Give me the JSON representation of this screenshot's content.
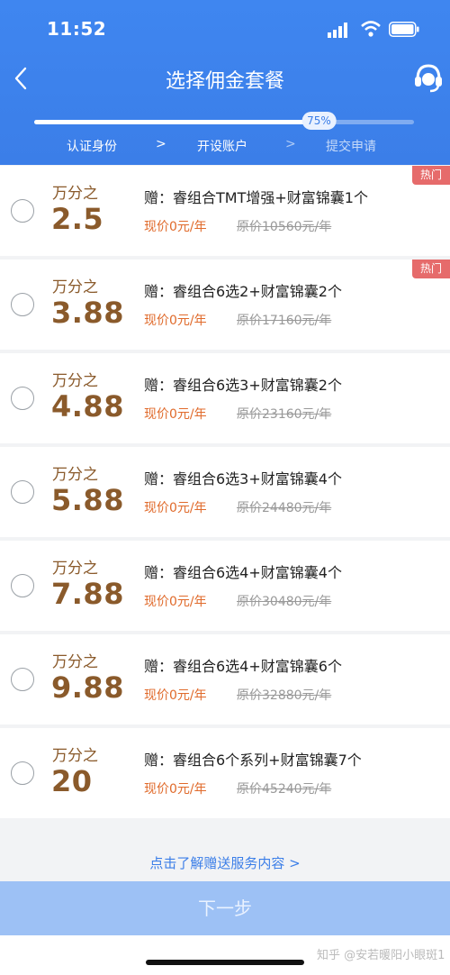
{
  "status_bar": {
    "time": "11:52"
  },
  "nav": {
    "title": "选择佣金套餐",
    "back_icon": "chevron-left-icon",
    "support_icon": "headset-icon"
  },
  "progress": {
    "percent": 75,
    "label": "75%"
  },
  "steps": [
    {
      "label": "认证身份",
      "state": "done"
    },
    {
      "label": "开设账户",
      "state": "current"
    },
    {
      "label": "提交申请",
      "state": "pending"
    }
  ],
  "step_separator": ">",
  "packages": [
    {
      "rate_unit": "万分之",
      "rate": "2.5",
      "gift": "赠：睿组合TMT增强+财富锦囊1个",
      "price_now": "现价0元/年",
      "price_orig": "原价10560元/年",
      "hot": "热门"
    },
    {
      "rate_unit": "万分之",
      "rate": "3.88",
      "gift": "赠：睿组合6选2+财富锦囊2个",
      "price_now": "现价0元/年",
      "price_orig": "原价17160元/年",
      "hot": "热门"
    },
    {
      "rate_unit": "万分之",
      "rate": "4.88",
      "gift": "赠：睿组合6选3+财富锦囊2个",
      "price_now": "现价0元/年",
      "price_orig": "原价23160元/年",
      "hot": ""
    },
    {
      "rate_unit": "万分之",
      "rate": "5.88",
      "gift": "赠：睿组合6选3+财富锦囊4个",
      "price_now": "现价0元/年",
      "price_orig": "原价24480元/年",
      "hot": ""
    },
    {
      "rate_unit": "万分之",
      "rate": "7.88",
      "gift": "赠：睿组合6选4+财富锦囊4个",
      "price_now": "现价0元/年",
      "price_orig": "原价30480元/年",
      "hot": ""
    },
    {
      "rate_unit": "万分之",
      "rate": "9.88",
      "gift": "赠：睿组合6选4+财富锦囊6个",
      "price_now": "现价0元/年",
      "price_orig": "原价32880元/年",
      "hot": ""
    },
    {
      "rate_unit": "万分之",
      "rate": "20",
      "gift": "赠：睿组合6个系列+财富锦囊7个",
      "price_now": "现价0元/年",
      "price_orig": "原价45240元/年",
      "hot": ""
    }
  ],
  "learn_more": "点击了解赠送服务内容 >",
  "next_button": "下一步",
  "watermark": "知乎 @安若暖阳小眼斑1",
  "colors": {
    "header": "#3f86f0",
    "rate": "#8a5a2b",
    "price_now": "#e06a2b",
    "hot": "#e66b6b",
    "next_button": "#9dc1f5"
  }
}
